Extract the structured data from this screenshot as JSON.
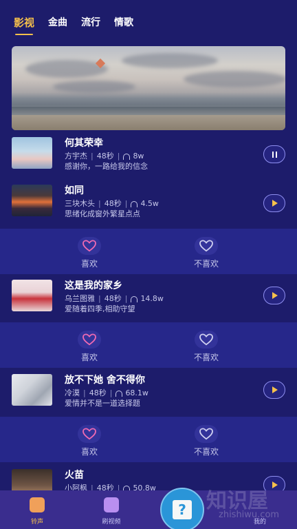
{
  "tabs": [
    {
      "label": "影视",
      "active": true
    },
    {
      "label": "金曲",
      "active": false
    },
    {
      "label": "流行",
      "active": false
    },
    {
      "label": "情歌",
      "active": false
    }
  ],
  "songs": [
    {
      "title": "何其荣幸",
      "artist": "方宇杰",
      "duration": "48秒",
      "plays": "8w",
      "desc": "感谢你，一路给我的信念",
      "state": "pause"
    },
    {
      "title": "如同",
      "artist": "三块木头",
      "duration": "48秒",
      "plays": "4.5w",
      "desc": "思绪化成窗外繁星点点",
      "state": "play"
    },
    {
      "title": "这是我的家乡",
      "artist": "乌兰图雅",
      "duration": "48秒",
      "plays": "14.8w",
      "desc": "爱随着四季,相助守望",
      "state": "play"
    },
    {
      "title": "放不下她 舍不得你",
      "artist": "冷漠",
      "duration": "48秒",
      "plays": "68.1w",
      "desc": "爱情并不是一道选择题",
      "state": "play"
    },
    {
      "title": "火苗",
      "artist": "小阿枫",
      "duration": "48秒",
      "plays": "50.8w",
      "desc": "",
      "state": "play"
    }
  ],
  "vote": {
    "like": "喜欢",
    "dislike": "不喜欢"
  },
  "bottom_nav": [
    {
      "label": "铃声",
      "active": true
    },
    {
      "label": "刷视频",
      "active": false
    },
    {
      "label": "",
      "active": false
    },
    {
      "label": "我的",
      "active": false
    }
  ],
  "watermark": {
    "text": "知识屋",
    "sub": "zhishiwu.com"
  },
  "colors": {
    "accent": "#f6c14b",
    "background": "#1d1c6b",
    "vote_band": "#26278a",
    "heart_like": "#f06ab2"
  }
}
